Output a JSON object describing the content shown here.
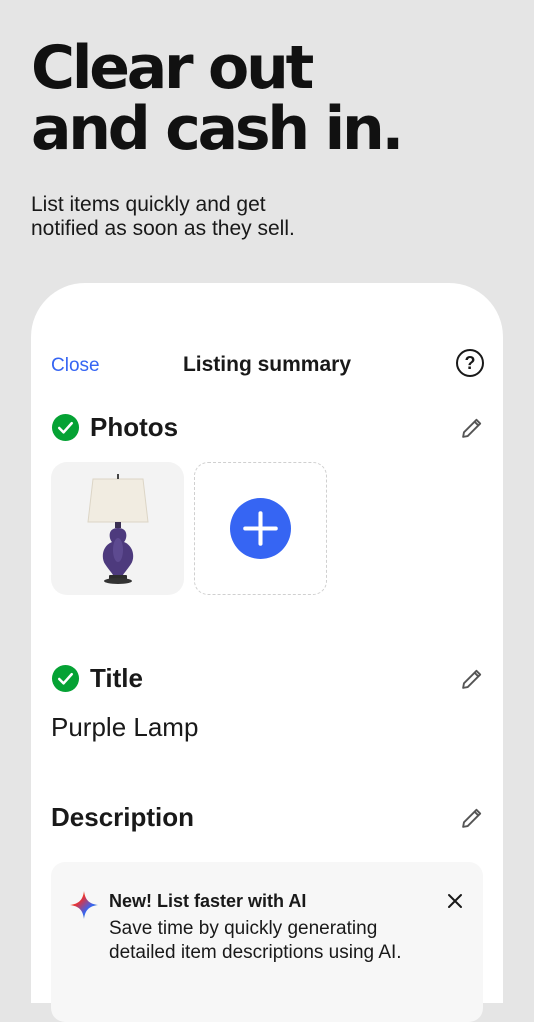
{
  "promo": {
    "headline_line1": "Clear out",
    "headline_line2": "and cash in.",
    "subtext_line1": "List items quickly and get",
    "subtext_line2": "notified as soon as they sell."
  },
  "listing": {
    "close_label": "Close",
    "title": "Listing summary",
    "help_label": "?",
    "photos": {
      "heading": "Photos",
      "status": "complete",
      "items": [
        {
          "icon": "purple-lamp-photo"
        }
      ],
      "add_icon": "plus-icon"
    },
    "title_section": {
      "heading": "Title",
      "status": "complete",
      "value": "Purple Lamp"
    },
    "description": {
      "heading": "Description",
      "ai_card": {
        "heading": "New! List faster with AI",
        "body": "Save time by quickly generating detailed item descriptions using AI."
      }
    }
  },
  "colors": {
    "accent": "#3665f3",
    "success": "#05a234",
    "lamp_body": "#4d3a7d",
    "background": "#e5e5e5"
  }
}
